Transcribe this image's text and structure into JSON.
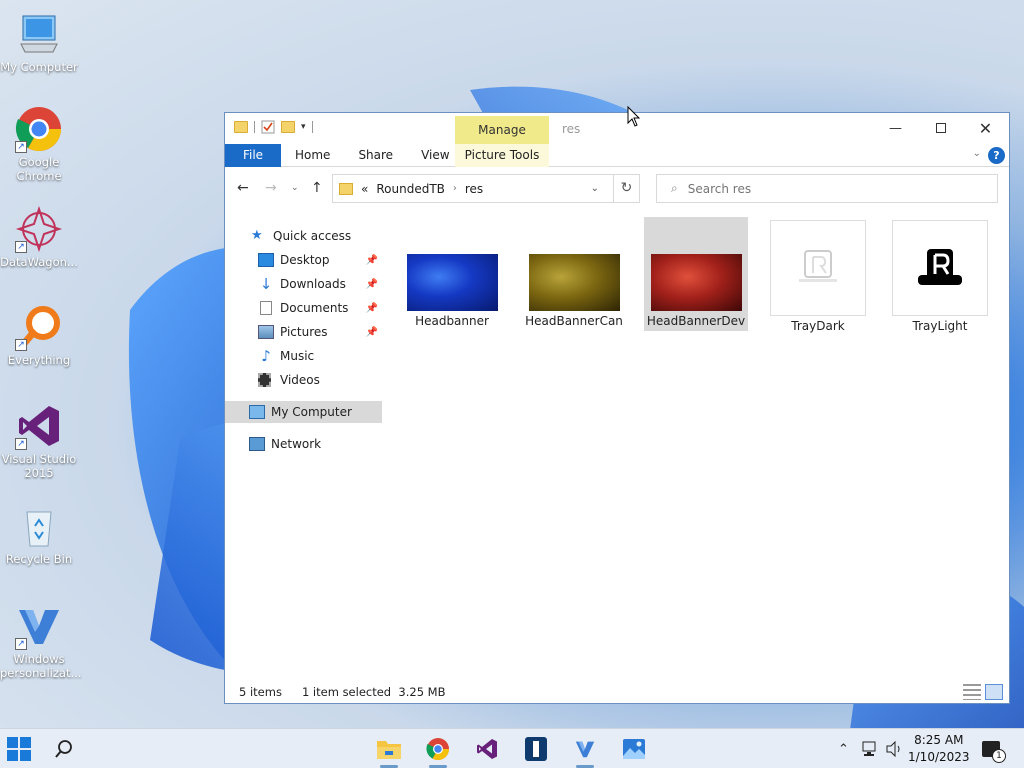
{
  "desktop": {
    "icons": [
      {
        "label": "My Computer"
      },
      {
        "label": "Google Chrome"
      },
      {
        "label": "DataWagon..."
      },
      {
        "label": "Everything"
      },
      {
        "label": "Visual Studio 2015"
      },
      {
        "label": "Recycle Bin"
      },
      {
        "label": "Windows personalizat..."
      }
    ]
  },
  "window": {
    "title": "res",
    "manage_tab": "Manage",
    "ribbon": {
      "file": "File",
      "tabs": [
        "Home",
        "Share",
        "View"
      ],
      "picture_tools": "Picture Tools"
    },
    "address": {
      "overflow": "«",
      "crumbs": [
        "RoundedTB",
        "res"
      ]
    },
    "search": {
      "placeholder": "Search res"
    },
    "nav": {
      "quick_access": "Quick access",
      "items": [
        "Desktop",
        "Downloads",
        "Documents",
        "Pictures",
        "Music",
        "Videos"
      ],
      "my_computer": "My Computer",
      "network": "Network"
    },
    "files": [
      {
        "name": "Headbanner"
      },
      {
        "name": "HeadBannerCan"
      },
      {
        "name": "HeadBannerDev"
      },
      {
        "name": "TrayDark"
      },
      {
        "name": "TrayLight"
      }
    ],
    "status": {
      "items": "5 items",
      "selection": "1 item selected  3.25 MB"
    }
  },
  "taskbar": {
    "time": "8:25 AM",
    "date": "1/10/2023",
    "notification_count": "1"
  },
  "colors": {
    "accent": "#1a6ac7",
    "manage_tab": "#f0ea8a",
    "selection": "#d9d9d9"
  }
}
